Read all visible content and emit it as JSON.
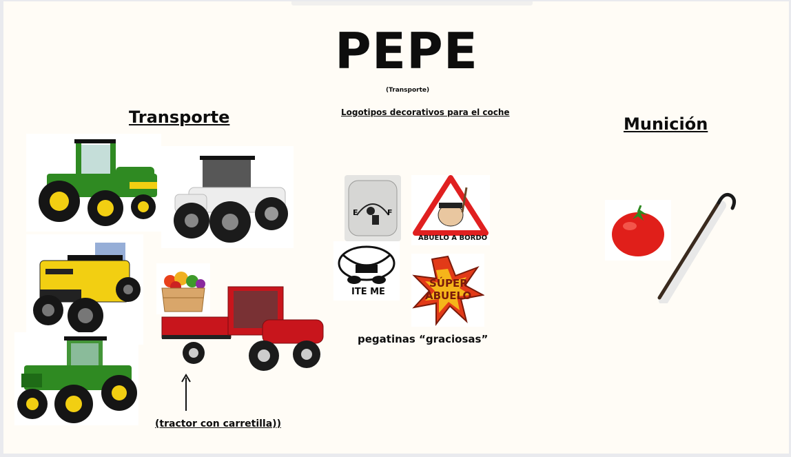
{
  "slide": {
    "title": "PEPE",
    "subtitle": "(Transporte)",
    "transport_heading": "Transporte ",
    "logos_heading": "Logotipos decorativos para el coche",
    "ammo_heading": "Munición",
    "stickers_caption": "pegatinas “graciosas”",
    "trailer_caption": "(tractor con carretilla))"
  },
  "stickers": {
    "fuel_left": "E",
    "fuel_right": "F",
    "abuelo_bordo": "ABUELO A BORDO",
    "ite_me": "ITE ME",
    "super_line1": "SÚPER",
    "super_line2": "ABUELO"
  },
  "colors": {
    "tractor_green": "#2f8a22",
    "tractor_yellow": "#f2cf12",
    "tractor_white": "#ededed",
    "trailer_red": "#c8151c",
    "tomato_red": "#e01f1a",
    "warning_red": "#e02020"
  }
}
